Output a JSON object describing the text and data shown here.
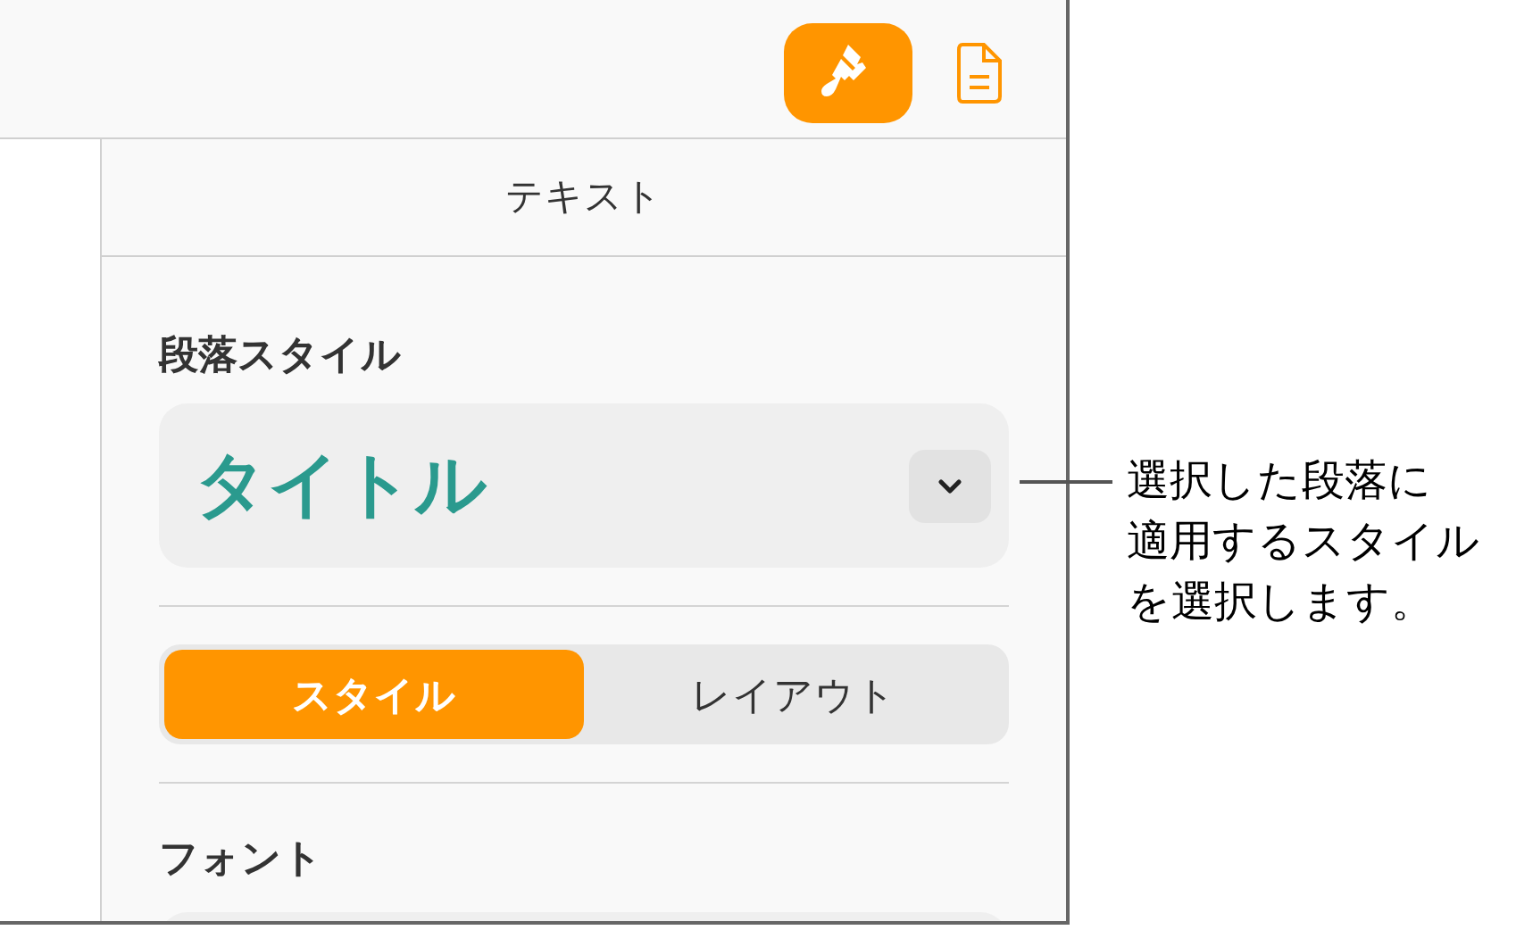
{
  "toolbar": {
    "buttons": [
      {
        "kind": "format",
        "selected": true
      },
      {
        "kind": "document",
        "selected": false
      }
    ]
  },
  "sidebar": {
    "title": "テキスト",
    "paragraph_style": {
      "label": "段落スタイル",
      "value": "タイトル"
    },
    "tabs": [
      {
        "label": "スタイル",
        "selected": true
      },
      {
        "label": "レイアウト",
        "selected": false
      }
    ],
    "font": {
      "label": "フォント"
    }
  },
  "callout": {
    "lines": [
      "選択した段落に",
      "適用するスタイル",
      "を選択します。"
    ]
  }
}
